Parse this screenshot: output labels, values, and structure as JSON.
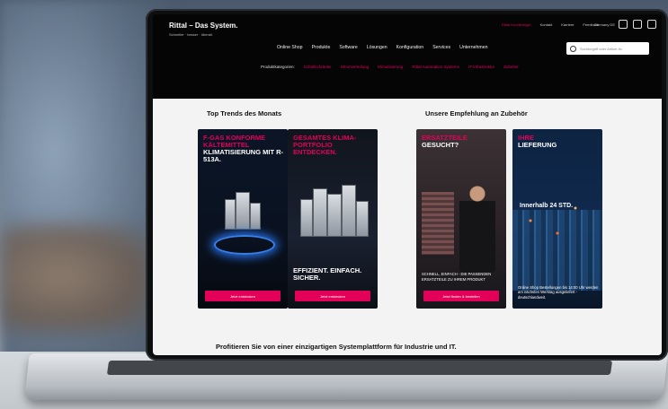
{
  "header": {
    "logo": "Rittal – Das System.",
    "logo_tagline": "Schneller · besser · überall.",
    "top_links": [
      "Rittal Kundenlogin",
      "Kontakt",
      "Karriere",
      "Feedback"
    ],
    "language": "Germany DE",
    "search_placeholder": "Suchbegriff oder Artikel-Nr.",
    "nav": [
      "Online Shop",
      "Produkte",
      "Software",
      "Lösungen",
      "Konfiguration",
      "Services",
      "Unternehmen"
    ],
    "categories_label": "Produktkategorien:",
    "categories": [
      "Schaltschränke",
      "Stromverteilung",
      "Klimatisierung",
      "Rittal Automation Systems",
      "IT-Infrastruktur",
      "Zubehör"
    ]
  },
  "sections": {
    "left_heading": "Top Trends des Monats",
    "right_heading": "Unsere Empfehlung an Zubehör"
  },
  "cards": [
    {
      "red_text": "F-GAS KONFORME KÄLTEMITTEL",
      "white_text": "KLIMATISIERUNG MIT R-513A.",
      "button": "Jetzt entdecken"
    },
    {
      "red_text": "GESAMTES KLIMA-PORTFOLIO ENTDECKEN.",
      "bottom_text": "EFFIZIENT. EINFACH. SICHER.",
      "button": "Jetzt entdecken"
    },
    {
      "red_text": "ERSATZTEILE",
      "white_text": "GESUCHT?",
      "small_text": "SCHNELL, EINFACH - DIE PASSENDEN ERSATZTEILE ZU IHREM PRODUKT",
      "button": "Jetzt finden & bestellen"
    },
    {
      "red_text": "IHRE",
      "white_text": "LIEFERUNG",
      "middle_text": "Innerhalb 24 STD.",
      "small_text": "Online Shop Bestellungen bis 14:00 Uhr werden am nächsten Werktag ausgeliefert - deutschlandweit."
    }
  ],
  "footer_tagline": "Profitieren Sie von einer einzigartigen Systemplattform für Industrie und IT.",
  "colors": {
    "accent": "#e30059",
    "header_bg": "#050505",
    "content_bg": "#f3f3f3"
  }
}
